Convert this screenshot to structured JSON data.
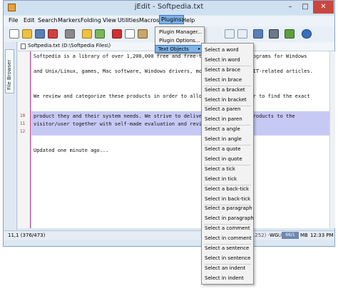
{
  "window": {
    "title": "jEdit - Softpedia.txt",
    "controls": {
      "minimize": "–",
      "maximize": "□",
      "close": "✕"
    }
  },
  "menubar": [
    "File",
    "Edit",
    "Search",
    "Markers",
    "Folding",
    "View",
    "Utilities",
    "Macros",
    "Plugins",
    "Help"
  ],
  "plugins_menu": {
    "items": [
      "Plugin Manager...",
      "Plugin Options...",
      "Text Objects"
    ],
    "submenu_arrow": "▸"
  },
  "text_objects_menu": [
    "Select a word",
    "Select in word",
    "Select a brace",
    "Select in brace",
    "Select a bracket",
    "Select in bracket",
    "Select a paren",
    "Select in paren",
    "Select a angle",
    "Select in angle",
    "Select a quote",
    "Select in quote",
    "Select a tick",
    "Select in tick",
    "Select a back-tick",
    "Select in back-tick",
    "Select a paragraph",
    "Select in paragraph",
    "Select a comment",
    "Select in comment",
    "Select a sentence",
    "Select in sentence",
    "Select an indent",
    "Select in indent"
  ],
  "sidebar": {
    "tab_label": "File Browser"
  },
  "buffer": {
    "label": "Softpedia.txt (D:\\Softpedia Files\\)"
  },
  "editor": {
    "lines": [
      "Softpedia is a library of over 1,200,000 free and free-to-try software programs for Windows",
      "",
      "and Unix/Linux, games, Mac software, Windows drivers, mobile devices and IT-related articles.",
      "",
      "",
      "We review and categorize these products in order to allow the visitor/user to find the exact",
      "",
      "",
      "product they and their system needs. We strive to deliver only the best products to the",
      "visitor/user together with self-made evaluation and review notes.",
      "",
      "",
      "Updated one minute ago..."
    ],
    "line_numbers": [
      "10",
      "11",
      "12"
    ]
  },
  "status": {
    "position": "11,1 (376/473)",
    "mode": "(text,none,Cp1252) - - - UG",
    "wg": "WG",
    "memory": "66/1",
    "memory_unit": "MB",
    "time": "12:33 PM"
  },
  "colors": {
    "selection": "#c7c9f5",
    "menu_highlight": "#7fb1e6",
    "close_button": "#c9473f",
    "gutter_marker": "#c94a9a"
  }
}
